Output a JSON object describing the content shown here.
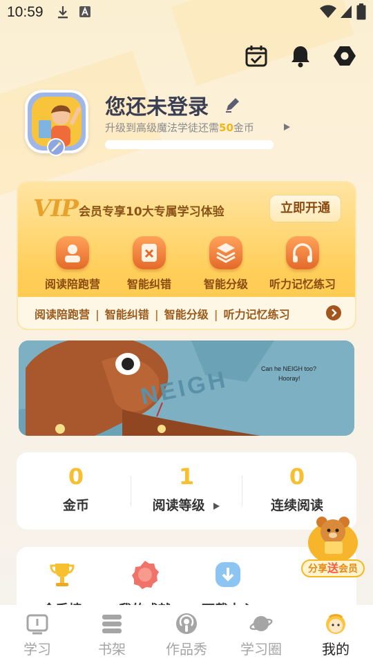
{
  "status_bar": {
    "time": "10:59"
  },
  "profile": {
    "name": "您还未登录",
    "subtitle_prefix": "升级到高级魔法学徒还需",
    "subtitle_amount": "50",
    "subtitle_suffix": "金币"
  },
  "vip": {
    "logo": "VIP",
    "slogan": "会员专享10大专属学习体验",
    "cta": "立即开通",
    "features": [
      "阅读陪跑营",
      "智能纠错",
      "智能分级",
      "听力记忆练习"
    ],
    "marquee": [
      "阅读陪跑营",
      "智能纠错",
      "智能分级",
      "听力记忆练习"
    ]
  },
  "banner": {
    "line1": "Can he NEIGH too?",
    "line2": "Hooray!",
    "word": "NEIGH"
  },
  "stats": [
    {
      "value": "0",
      "label": "金币"
    },
    {
      "value": "1",
      "label": "阅读等级"
    },
    {
      "value": "0",
      "label": "连续阅读"
    }
  ],
  "tools": [
    "金手榜",
    "我的成就",
    "下载中心"
  ],
  "share": {
    "pre": "分享",
    "em": "送",
    "post": "会员"
  },
  "tabs": [
    {
      "label": "学习"
    },
    {
      "label": "书架"
    },
    {
      "label": "作品秀"
    },
    {
      "label": "学习圈"
    },
    {
      "label": "我的"
    }
  ],
  "colors": {
    "accent": "#f6c030",
    "vip_brown": "#8a4a10",
    "text_dark": "#3a3e52"
  }
}
